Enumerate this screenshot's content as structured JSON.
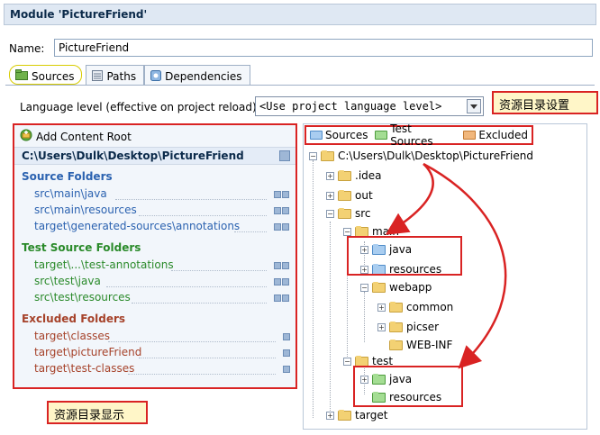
{
  "window": {
    "title": "Module 'PictureFriend'"
  },
  "name_field": {
    "label": "Name:",
    "value": "PictureFriend"
  },
  "tabs": [
    {
      "label": "Sources",
      "icon": "folder-icon"
    },
    {
      "label": "Paths",
      "icon": "paths-icon"
    },
    {
      "label": "Dependencies",
      "icon": "dependencies-icon"
    }
  ],
  "language_level": {
    "label": "Language level (effective on project reload):",
    "value": "<Use project language level>"
  },
  "annotations": {
    "settings": "资源目录设置",
    "display": "资源目录显示"
  },
  "left_panel": {
    "add_root": "Add Content Root",
    "root_path": "C:\\Users\\Dulk\\Desktop\\PictureFriend",
    "source_folders": {
      "heading": "Source Folders",
      "items": [
        "src\\main\\java",
        "src\\main\\resources",
        "target\\generated-sources\\annotations"
      ]
    },
    "test_folders": {
      "heading": "Test Source Folders",
      "items": [
        "target\\...\\test-annotations",
        "src\\test\\java",
        "src\\test\\resources"
      ]
    },
    "excluded_folders": {
      "heading": "Excluded Folders",
      "items": [
        "target\\classes",
        "target\\pictureFriend",
        "target\\test-classes"
      ]
    }
  },
  "legend": {
    "sources": "Sources",
    "test_sources": "Test Sources",
    "excluded": "Excluded"
  },
  "tree": {
    "root": "C:\\Users\\Dulk\\Desktop\\PictureFriend",
    "idea": ".idea",
    "out": "out",
    "src": "src",
    "main": "main",
    "java": "java",
    "resources": "resources",
    "webapp": "webapp",
    "common": "common",
    "picser": "picser",
    "webinf": "WEB-INF",
    "test": "test",
    "test_java": "java",
    "test_resources": "resources",
    "target": "target"
  },
  "colors": {
    "highlight": "#d92323",
    "source_blue": "#2b62b0",
    "test_green": "#2a8a2a",
    "excluded_orange": "#a6422a"
  }
}
